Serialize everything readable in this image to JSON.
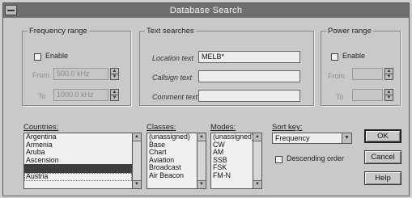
{
  "window": {
    "title": "Database Search"
  },
  "frequency_range": {
    "legend": "Frequency range",
    "enable_label": "Enable",
    "from_label": "From",
    "to_label": "To",
    "from_value": "500.0 kHz",
    "to_value": "1000.0 kHz"
  },
  "text_searches": {
    "legend": "Text searches",
    "location_label": "Location text",
    "location_value": "MELB*",
    "callsign_label": "Callsign text",
    "callsign_value": "",
    "comment_label": "Comment text",
    "comment_value": ""
  },
  "power_range": {
    "legend": "Power range",
    "enable_label": "Enable",
    "from_label": "From",
    "to_label": "To",
    "from_value": "",
    "to_value": ""
  },
  "countries": {
    "label": "Countries:",
    "items": [
      "Argentina",
      "Armenia",
      "Aruba",
      "Ascension",
      "",
      "Austria"
    ]
  },
  "classes": {
    "label": "Classes:",
    "items": [
      "(unassigned)",
      "Base",
      "Chart",
      "Aviation",
      "Broadcast",
      "Air Beacon"
    ]
  },
  "modes": {
    "label": "Modes:",
    "items": [
      "(unassigned)",
      "CW",
      "AM",
      "SSB",
      "FSK",
      "FM-N"
    ]
  },
  "sort": {
    "label": "Sort key:",
    "value": "Frequency",
    "descending_label": "Descending order"
  },
  "buttons": {
    "ok": "OK",
    "cancel": "Cancel",
    "help": "Help"
  }
}
